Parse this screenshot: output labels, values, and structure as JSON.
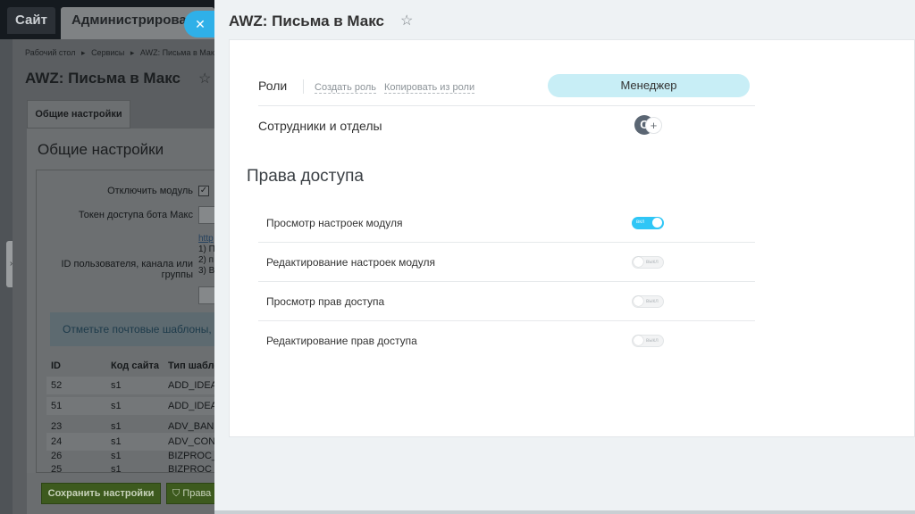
{
  "background": {
    "top_tabs": {
      "site": "Сайт",
      "admin": "Администрирование"
    },
    "breadcrumbs": [
      "Рабочий стол",
      "▸",
      "Сервисы",
      "▸",
      "AWZ: Письма в Макс",
      "▸"
    ],
    "page_title": "AWZ: Письма в Макс",
    "tab_label": "Общие настройки",
    "section_title": "Общие настройки",
    "form": {
      "disable_module_label": "Отключить модуль",
      "disable_module_checked": "✓",
      "bot_token_label": "Токен доступа бота Макс",
      "user_id_label": "ID пользователя, канала или группы",
      "user_id_link": "http",
      "user_id_notes": [
        "1) П",
        "2) п",
        "3) В"
      ]
    },
    "info_text": "Отметьте почтовые шаблоны, ко",
    "table": {
      "headers": [
        "ID",
        "Код сайта",
        "Тип шаблона"
      ],
      "rows": [
        [
          "52",
          "s1",
          "ADD_IDEA"
        ],
        [
          "51",
          "s1",
          "ADD_IDEA"
        ],
        [
          "23",
          "s1",
          "ADV_BANNER"
        ],
        [
          "24",
          "s1",
          "ADV_CONTRACT"
        ],
        [
          "26",
          "s1",
          "BIZPROC_"
        ],
        [
          "25",
          "s1",
          "BIZPROC_"
        ]
      ]
    },
    "buttons": {
      "save": "Сохранить настройки",
      "rights": "Права"
    }
  },
  "slider": {
    "title": "AWZ: Письма в Макс",
    "star_icon": "star-outline-icon",
    "close_icon": "✕",
    "roles": {
      "label": "Роли",
      "create_link": "Создать роль",
      "copy_link": "Копировать из роли",
      "active_role": "Менеджер"
    },
    "employees": {
      "label": "Сотрудники и отделы",
      "avatar_letter": "C",
      "add_icon": "+"
    },
    "access_section_title": "Права доступа",
    "permissions": [
      {
        "label": "Просмотр настроек модуля",
        "state": "вкл",
        "enabled": true
      },
      {
        "label": "Редактирование настроек модуля",
        "state": "выкл",
        "enabled": false
      },
      {
        "label": "Просмотр прав доступа",
        "state": "выкл",
        "enabled": false
      },
      {
        "label": "Редактирование прав доступа",
        "state": "выкл",
        "enabled": false
      }
    ]
  },
  "colors": {
    "accent": "#2fc6f6",
    "close_button": "#2fb0e8",
    "role_pill": "#c8eef6",
    "save_button": "#3d5a1e"
  }
}
